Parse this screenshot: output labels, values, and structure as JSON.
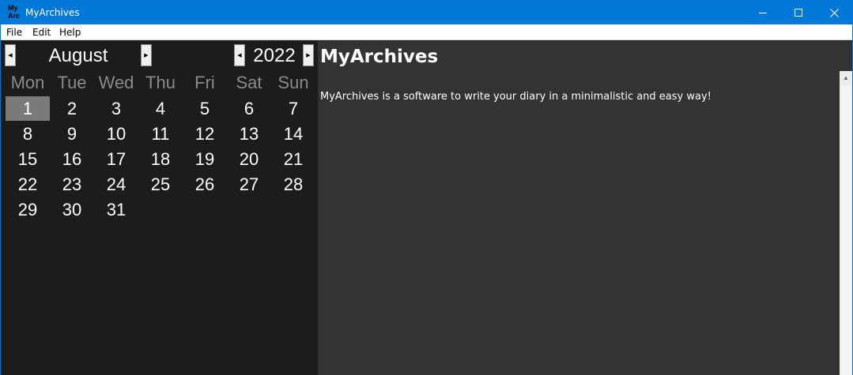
{
  "window": {
    "title": "MyArchives",
    "icon_text_line1": "My",
    "icon_text_line2": "Arc"
  },
  "menu": {
    "file": "File",
    "edit": "Edit",
    "help": "Help"
  },
  "calendar": {
    "month": "August",
    "year": "2022",
    "weekdays": [
      "Mon",
      "Tue",
      "Wed",
      "Thu",
      "Fri",
      "Sat",
      "Sun"
    ],
    "days": [
      "1",
      "2",
      "3",
      "4",
      "5",
      "6",
      "7",
      "8",
      "9",
      "10",
      "11",
      "12",
      "13",
      "14",
      "15",
      "16",
      "17",
      "18",
      "19",
      "20",
      "21",
      "22",
      "23",
      "24",
      "25",
      "26",
      "27",
      "28",
      "29",
      "30",
      "31"
    ],
    "selected_day": "1"
  },
  "content": {
    "title": "MyArchives",
    "body": "MyArchives is a software to write your diary in a minimalistic and easy way!"
  },
  "icons": {
    "prev": "triangle-left",
    "next": "triangle-right",
    "scroll_up": "triangle-up"
  }
}
